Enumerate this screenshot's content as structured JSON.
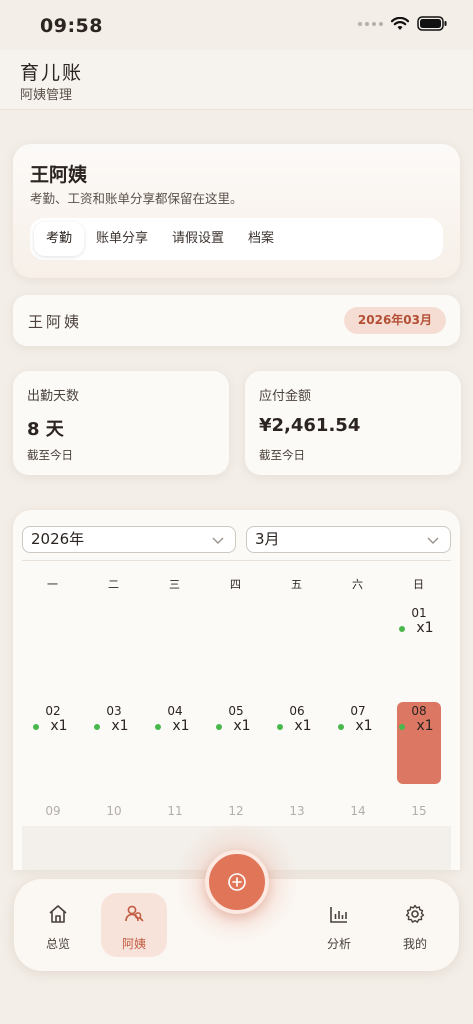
{
  "status": {
    "time": "09:58"
  },
  "header": {
    "title": "育儿账",
    "subtitle": "阿姨管理"
  },
  "profile": {
    "name": "王阿姨",
    "description": "考勤、工资和账单分享都保留在这里。",
    "tabs": [
      "考勤",
      "账单分享",
      "请假设置",
      "档案"
    ],
    "active_tab": "考勤"
  },
  "caregiver": {
    "name": "王阿姨",
    "month": "2026年03月"
  },
  "stats": {
    "attendance": {
      "label": "出勤天数",
      "value": "8 天",
      "note": "截至今日"
    },
    "payable": {
      "label": "应付金额",
      "value": "¥2,461.54",
      "note": "截至今日"
    }
  },
  "calendar": {
    "year": "2026年",
    "month": "3月",
    "weekdays": [
      "一",
      "二",
      "三",
      "四",
      "五",
      "六",
      "日"
    ],
    "days": [
      {
        "num": "01",
        "count": "x1"
      },
      {
        "num": "02",
        "count": "x1"
      },
      {
        "num": "03",
        "count": "x1"
      },
      {
        "num": "04",
        "count": "x1"
      },
      {
        "num": "05",
        "count": "x1"
      },
      {
        "num": "06",
        "count": "x1"
      },
      {
        "num": "07",
        "count": "x1"
      },
      {
        "num": "08",
        "count": "x1"
      },
      {
        "num": "09"
      },
      {
        "num": "10"
      },
      {
        "num": "11"
      },
      {
        "num": "12"
      },
      {
        "num": "13"
      },
      {
        "num": "14"
      },
      {
        "num": "15"
      }
    ],
    "attendance_dot_color": "#49b84a",
    "selected_color": "#dc7763"
  },
  "nav": {
    "items": [
      {
        "label": "总览",
        "icon": "home-icon"
      },
      {
        "label": "阿姨",
        "icon": "user-group-icon"
      },
      {
        "label": "分析",
        "icon": "bar-chart-icon"
      },
      {
        "label": "我的",
        "icon": "gear-icon"
      }
    ],
    "active": "阿姨",
    "fab_icon": "plus-circle-icon",
    "accent": "#e07558"
  }
}
